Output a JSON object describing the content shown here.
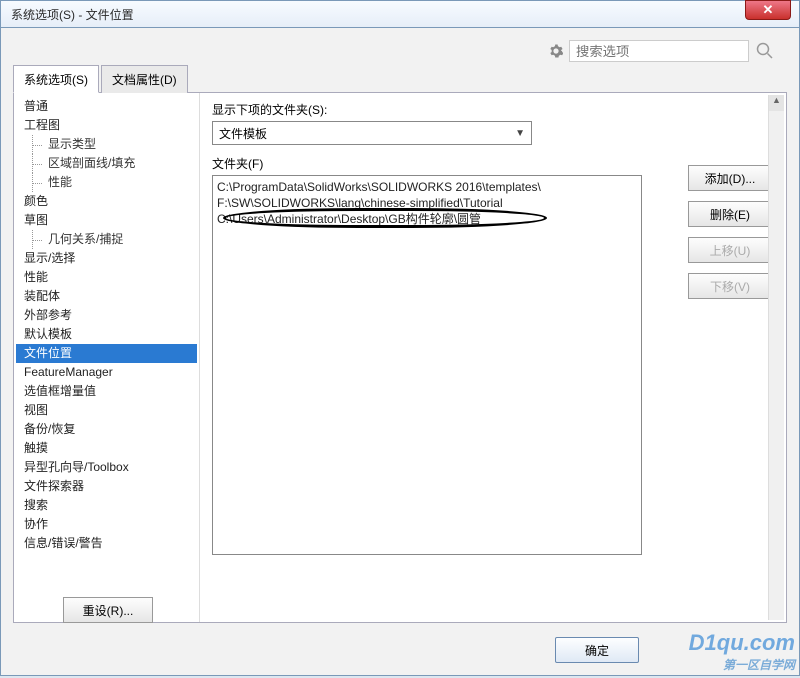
{
  "title": "系统选项(S) - 文件位置",
  "close_glyph": "✕",
  "search": {
    "placeholder": "搜索选项"
  },
  "tabs": {
    "system": "系统选项(S)",
    "docprops": "文档属性(D)"
  },
  "tree": {
    "items": [
      {
        "label": "普通"
      },
      {
        "label": "工程图",
        "children": [
          {
            "label": "显示类型"
          },
          {
            "label": "区域剖面线/填充"
          },
          {
            "label": "性能"
          }
        ]
      },
      {
        "label": "颜色"
      },
      {
        "label": "草图",
        "children": [
          {
            "label": "几何关系/捕捉"
          }
        ]
      },
      {
        "label": "显示/选择"
      },
      {
        "label": "性能"
      },
      {
        "label": "装配体"
      },
      {
        "label": "外部参考"
      },
      {
        "label": "默认模板"
      },
      {
        "label": "文件位置",
        "selected": true
      },
      {
        "label": "FeatureManager"
      },
      {
        "label": "选值框增量值"
      },
      {
        "label": "视图"
      },
      {
        "label": "备份/恢复"
      },
      {
        "label": "触摸"
      },
      {
        "label": "异型孔向导/Toolbox"
      },
      {
        "label": "文件探索器"
      },
      {
        "label": "搜索"
      },
      {
        "label": "协作"
      },
      {
        "label": "信息/错误/警告"
      }
    ]
  },
  "right": {
    "show_folders_label": "显示下项的文件夹(S):",
    "dropdown_value": "文件模板",
    "folder_label": "文件夹(F)",
    "folder_list": [
      "C:\\ProgramData\\SolidWorks\\SOLIDWORKS 2016\\templates\\",
      "F:\\SW\\SOLIDWORKS\\lang\\chinese-simplified\\Tutorial",
      "C:\\Users\\Administrator\\Desktop\\GB构件轮廓\\圆管"
    ],
    "buttons": {
      "add": "添加(D)...",
      "delete": "删除(E)",
      "up": "上移(U)",
      "down": "下移(V)"
    }
  },
  "reset_btn": "重设(R)...",
  "ok_btn": "确定",
  "watermark": {
    "big": "D1qu.com",
    "small": "第一区自学网"
  }
}
